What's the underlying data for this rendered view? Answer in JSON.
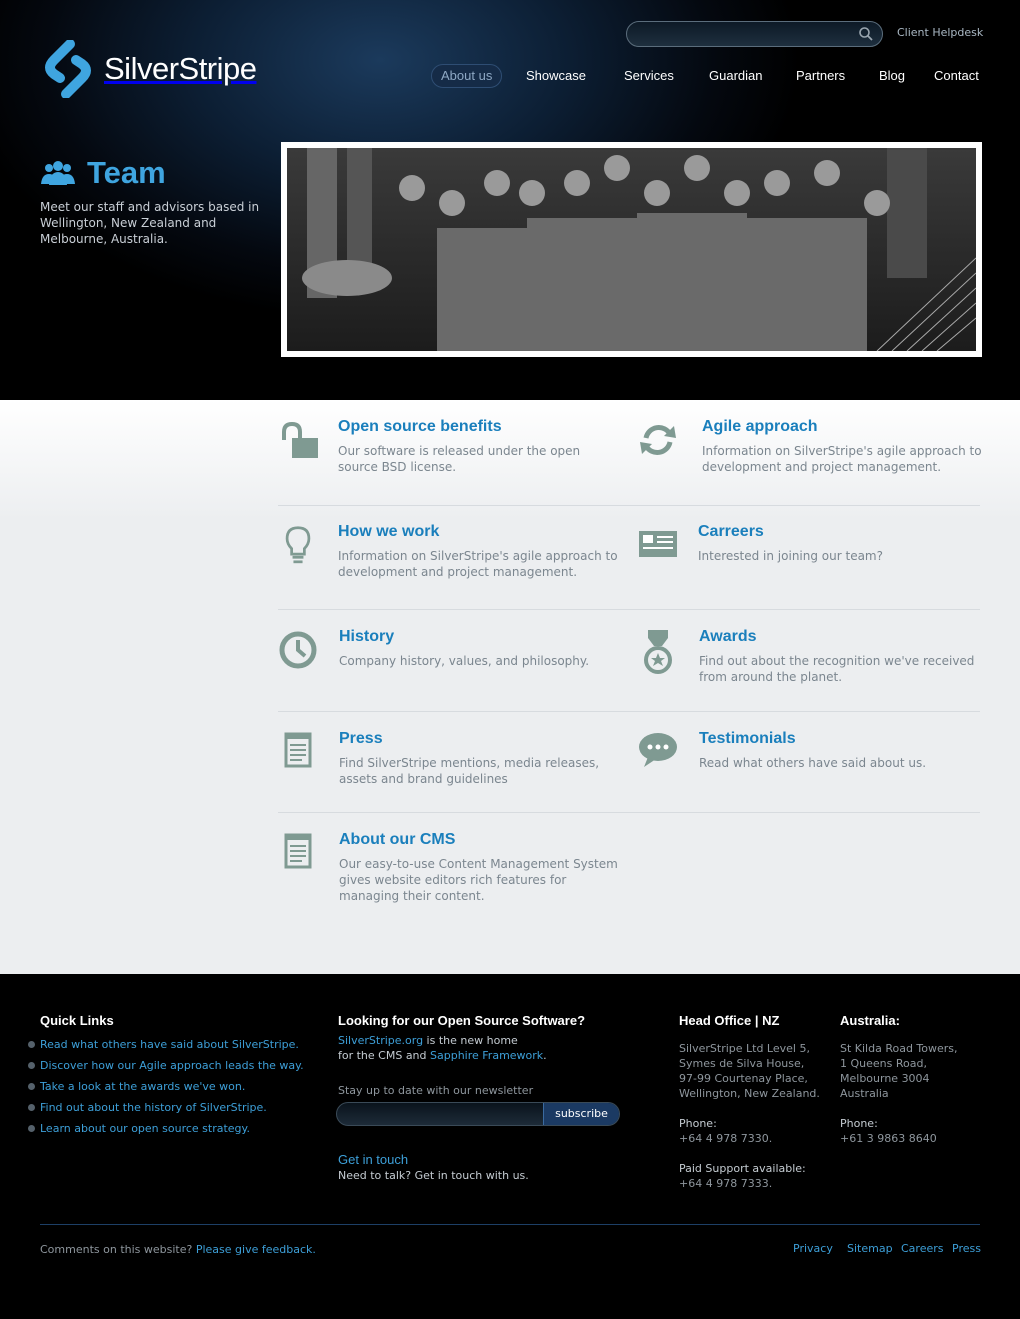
{
  "brand": {
    "name": "SilverStripe",
    "accent": "#3fa5e0",
    "link": "#3d9fd8"
  },
  "header": {
    "search_placeholder": "",
    "helpdesk": "Client Helpdesk",
    "nav": [
      "About us",
      "Showcase",
      "Services",
      "Guardian",
      "Partners",
      "Blog",
      "Contact"
    ],
    "active_nav": "About us"
  },
  "hero": {
    "title": "Team",
    "description": "Meet our staff and advisors based in Wellington, New Zealand and Melbourne, Australia.",
    "photo_icon": "team-photo"
  },
  "sections": [
    {
      "icon": "unlocked-padlock-icon",
      "title": "Open source benefits",
      "desc": "Our software is released under the open source BSD license."
    },
    {
      "icon": "refresh-arrows-icon",
      "title": "Agile approach",
      "desc": "Information on SilverStripe's agile approach to development and project management."
    },
    {
      "icon": "lightbulb-icon",
      "title": "How we work",
      "desc": "Information on SilverStripe's agile approach to development and project management."
    },
    {
      "icon": "id-card-icon",
      "title": "Carreers",
      "desc": "Interested in joining our team?"
    },
    {
      "icon": "clock-icon",
      "title": "History",
      "desc": "Company history, values, and philosophy."
    },
    {
      "icon": "medal-icon",
      "title": "Awards",
      "desc": "Find out about the recognition we've received from around the planet."
    },
    {
      "icon": "notepad-icon",
      "title": "Press",
      "desc": "Find SilverStripe mentions, media releases, assets and brand guidelines"
    },
    {
      "icon": "speech-bubble-icon",
      "title": "Testimonials",
      "desc": "Read what others have said about us."
    },
    {
      "icon": "notepad-icon",
      "title": "About our CMS",
      "desc": "Our easy-to-use Content Management System gives website editors rich features for managing their content."
    }
  ],
  "footer": {
    "quick_links_title": "Quick Links",
    "quick_links": [
      "Read what others have said about SilverStripe.",
      "Discover how our Agile approach leads the way.",
      "Take a look at the awards we've won.",
      "Find out about the history of SilverStripe.",
      "Learn about our open source strategy."
    ],
    "oss_title": "Looking for our Open Source Software?",
    "oss_link1": "SilverStripe.org",
    "oss_text1": " is the new home",
    "oss_text2": "for the CMS and ",
    "oss_link2": "Sapphire Framework",
    "oss_text3": ".",
    "newsletter_label": "Stay up to date with our newsletter",
    "subscribe": "subscribe",
    "get_in_touch": "Get in touch",
    "get_in_touch_desc": "Need to talk? Get in touch with us.",
    "nz_title": "Head Office | NZ",
    "nz_address": [
      "SilverStripe Ltd Level 5,",
      "Symes de Silva House,",
      "97-99 Courtenay Place,",
      "Wellington, New Zealand."
    ],
    "nz_phone_label": "Phone:",
    "nz_phone": "+64 4 978 7330.",
    "paid_support_label": "Paid Support available:",
    "paid_support_phone": "+64 4 978 7333.",
    "au_title": "Australia:",
    "au_address": [
      "St Kilda Road Towers,",
      "1 Queens Road,",
      "Melbourne 3004",
      "Australia"
    ],
    "au_phone_label": "Phone:",
    "au_phone": "+61 3 9863 8640",
    "comments_text": "Comments on this website? ",
    "feedback_link": "Please give feedback.",
    "bottom_links": [
      "Privacy",
      "Sitemap",
      "Careers",
      "Press"
    ]
  }
}
